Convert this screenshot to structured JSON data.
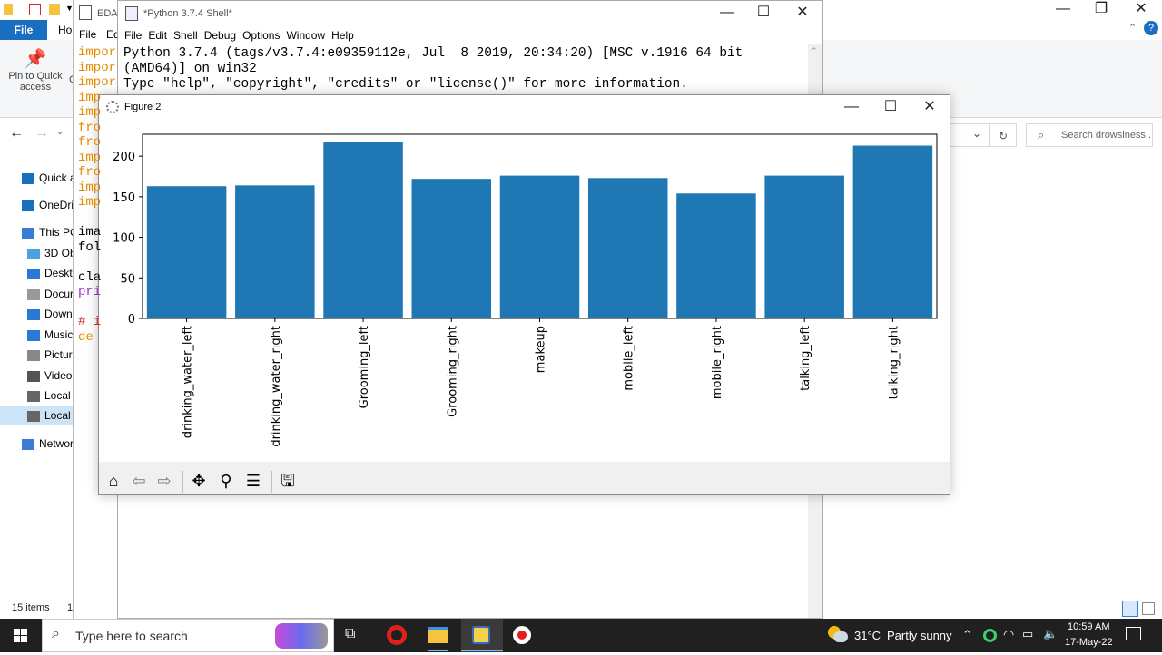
{
  "explorer": {
    "file_tab": "File",
    "home_tab": "Ho",
    "pin_label": "Pin to Quick access",
    "pin_label_short": "C",
    "search_placeholder": "Search drowsiness...",
    "sidebar": [
      {
        "label": "Quick a",
        "icon": "star-icon"
      },
      {
        "label": "OneDriv",
        "icon": "cloud-icon"
      },
      {
        "label": "This PC",
        "icon": "computer-icon"
      },
      {
        "label": "3D Ob",
        "icon": "cube-icon"
      },
      {
        "label": "Deskto",
        "icon": "desktop-icon"
      },
      {
        "label": "Docur",
        "icon": "document-icon"
      },
      {
        "label": "Down",
        "icon": "download-icon"
      },
      {
        "label": "Music",
        "icon": "music-icon"
      },
      {
        "label": "Pictur",
        "icon": "pictures-icon"
      },
      {
        "label": "Videos",
        "icon": "videos-icon"
      },
      {
        "label": "Local I",
        "icon": "drive-icon"
      },
      {
        "label": "Local I",
        "icon": "drive-icon"
      },
      {
        "label": "Networ",
        "icon": "network-icon"
      }
    ],
    "status": "15 items",
    "status_extra": "1"
  },
  "editor": {
    "title": "EDA",
    "menu_file": "File",
    "menu_edit": "Ed",
    "code_lines": [
      "impor",
      "impor",
      "impor",
      "imp",
      "imp",
      "fro",
      "fro",
      "imp",
      "fro",
      "imp",
      "imp",
      "",
      "ima",
      "fol",
      "",
      "cla",
      "pri",
      "",
      "# i",
      "de"
    ]
  },
  "shell": {
    "title": "*Python 3.7.4 Shell*",
    "menu": [
      "File",
      "Edit",
      "Shell",
      "Debug",
      "Options",
      "Window",
      "Help"
    ],
    "lines": [
      "Python 3.7.4 (tags/v3.7.4:e09359112e, Jul  8 2019, 20:34:20) [MSC v.1916 64 bit",
      "(AMD64)] on win32",
      "Type \"help\", \"copyright\", \"credits\" or \"license()\" for more information."
    ]
  },
  "figure": {
    "title": "Figure 2"
  },
  "chart_data": {
    "type": "bar",
    "categories": [
      "drinking_water_left",
      "drinking_water_right",
      "Grooming_left",
      "Grooming_right",
      "makeup",
      "mobile_left",
      "mobile_right",
      "talking_left",
      "talking_right"
    ],
    "values": [
      163,
      164,
      217,
      172,
      176,
      173,
      154,
      176,
      213
    ],
    "yticks": [
      0,
      50,
      100,
      150,
      200
    ],
    "ylim": [
      0,
      227
    ],
    "color": "#1f77b4",
    "title": "",
    "xlabel": "",
    "ylabel": ""
  },
  "taskbar": {
    "search_placeholder": "Type here to search",
    "temperature": "31°C",
    "weather": "Partly sunny",
    "time": "10:59 AM",
    "date": "17-May-22"
  }
}
